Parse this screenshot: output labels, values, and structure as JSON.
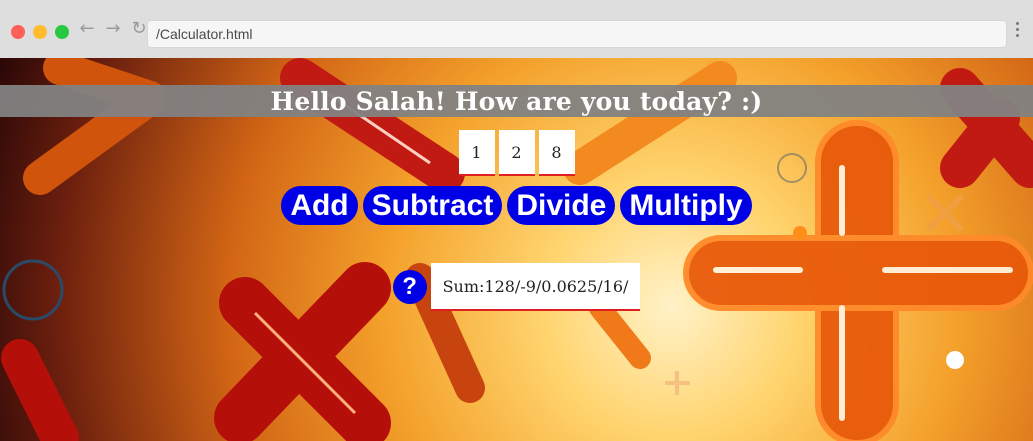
{
  "browser": {
    "address": "/Calculator.html"
  },
  "greeting": "Hello Salah! How are you today? :)",
  "inputs": [
    "1",
    "2",
    "8"
  ],
  "operations": {
    "add": "Add",
    "subtract": "Subtract",
    "divide": "Divide",
    "multiply": "Multiply"
  },
  "help": {
    "label": "?"
  },
  "result": "Sum:128/-9/0.0625/16/",
  "icons": {
    "back": "arrow-left-icon",
    "forward": "arrow-right-icon",
    "reload": "reload-icon",
    "menu": "kebab-menu-icon"
  },
  "colors": {
    "button": "#0000e6",
    "underline": "#e02020",
    "greeting_bar": "#828282"
  }
}
